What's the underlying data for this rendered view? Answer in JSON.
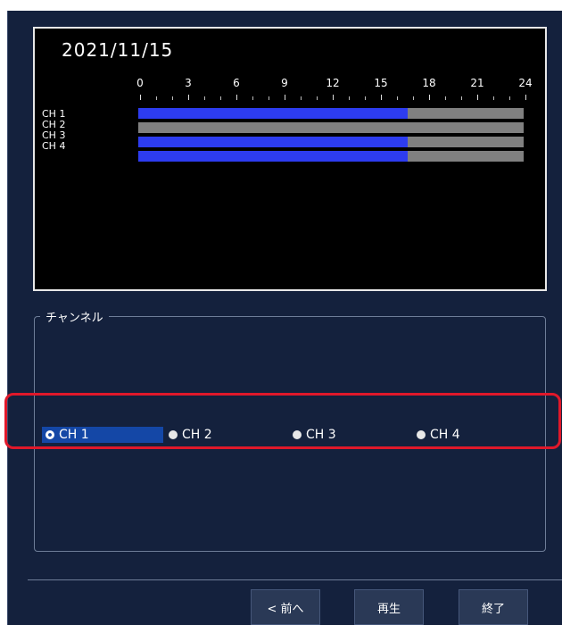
{
  "timeline": {
    "date": "2021/11/15",
    "hours": [
      "0",
      "3",
      "6",
      "9",
      "12",
      "15",
      "18",
      "21",
      "24"
    ],
    "channels": [
      {
        "label": "CH 1",
        "recorded_until_hour": 16.8
      },
      {
        "label": "CH 2",
        "recorded_until_hour": 0
      },
      {
        "label": "CH 3",
        "recorded_until_hour": 16.8
      },
      {
        "label": "CH 4",
        "recorded_until_hour": 16.8
      }
    ],
    "colors": {
      "recorded": "#2d3cf0",
      "empty": "#808080"
    }
  },
  "channel_group": {
    "legend": "チャンネル",
    "options": [
      {
        "label": "CH 1",
        "selected": true
      },
      {
        "label": "CH 2",
        "selected": false
      },
      {
        "label": "CH 3",
        "selected": false
      },
      {
        "label": "CH 4",
        "selected": false
      }
    ]
  },
  "footer": {
    "prev_label": "< 前へ",
    "play_label": "再生",
    "exit_label": "終了"
  }
}
